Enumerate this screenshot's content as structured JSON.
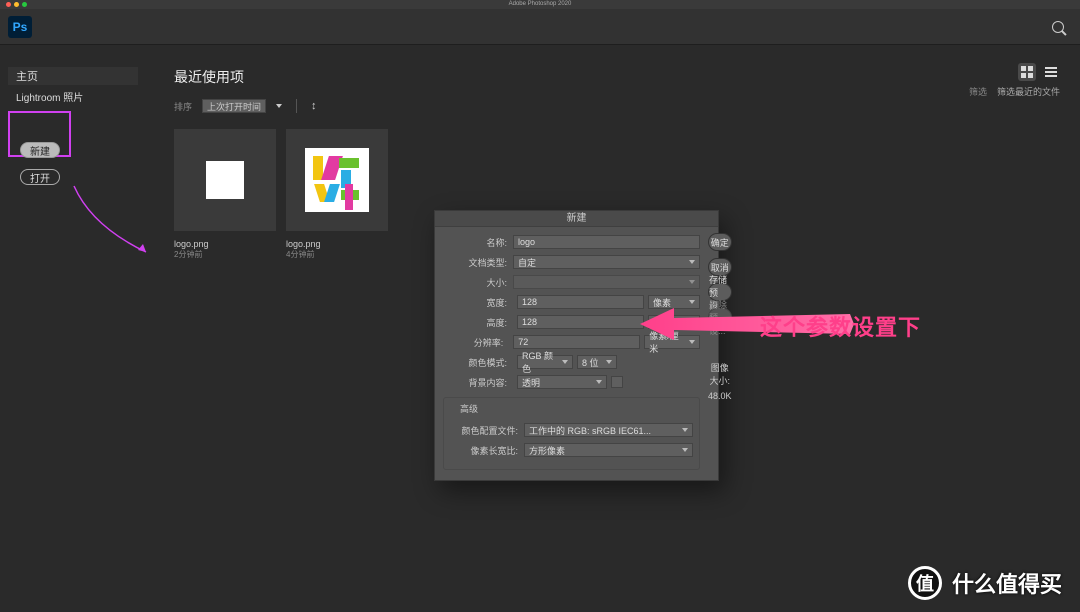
{
  "window": {
    "title": "Adobe Photoshop 2020",
    "logo": "Ps"
  },
  "sidebar": {
    "home": "主页",
    "lightroom": "Lightroom 照片",
    "new_btn": "新建",
    "open_btn": "打开"
  },
  "content": {
    "recent_heading": "最近使用项",
    "sort_label": "排序",
    "sort_value": "上次打开时间",
    "filter_label": "筛选",
    "filter_placeholder": "筛选最近的文件",
    "thumbs": [
      {
        "name": "logo.png",
        "when": "2分钟前"
      },
      {
        "name": "logo.png",
        "when": "4分钟前"
      }
    ]
  },
  "dialog": {
    "title": "新建",
    "name_label": "名称:",
    "name_value": "logo",
    "doctype_label": "文档类型:",
    "doctype_value": "自定",
    "size_label": "大小:",
    "width_label": "宽度:",
    "width_value": "128",
    "width_unit": "像素",
    "height_label": "高度:",
    "height_value": "128",
    "height_unit": "像素",
    "res_label": "分辨率:",
    "res_value": "72",
    "res_unit": "像素/厘米",
    "mode_label": "颜色模式:",
    "mode_value": "RGB 颜色",
    "bit_value": "8 位",
    "bg_label": "背景内容:",
    "bg_value": "透明",
    "advanced": "高级",
    "profile_label": "颜色配置文件:",
    "profile_value": "工作中的 RGB: sRGB IEC61...",
    "aspect_label": "像素长宽比:",
    "aspect_value": "方形像素",
    "imgsize_label": "图像大小:",
    "imgsize_value": "48.0K",
    "buttons": {
      "ok": "确定",
      "cancel": "取消",
      "save_preset": "存储预设...",
      "delete_preset": "删除预设..."
    }
  },
  "annotations": {
    "callout": "这个参数设置下"
  },
  "watermark": {
    "badge": "值",
    "text": "什么值得买"
  }
}
